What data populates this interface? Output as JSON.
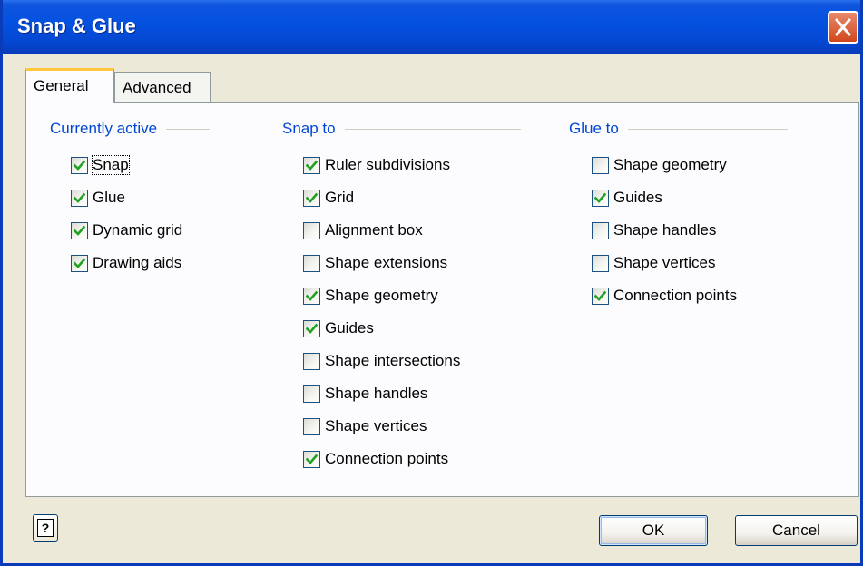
{
  "window": {
    "title": "Snap & Glue",
    "close_icon": "close-icon"
  },
  "tabs": [
    {
      "label": "General",
      "active": true
    },
    {
      "label": "Advanced",
      "active": false
    }
  ],
  "groups": {
    "currently_active": {
      "title": "Currently active",
      "items": [
        {
          "label": "Snap",
          "checked": true
        },
        {
          "label": "Glue",
          "checked": true
        },
        {
          "label": "Dynamic grid",
          "checked": true
        },
        {
          "label": "Drawing aids",
          "checked": true
        }
      ]
    },
    "snap_to": {
      "title": "Snap to",
      "items": [
        {
          "label": "Ruler subdivisions",
          "checked": true
        },
        {
          "label": "Grid",
          "checked": true
        },
        {
          "label": "Alignment box",
          "checked": false
        },
        {
          "label": "Shape extensions",
          "checked": false
        },
        {
          "label": "Shape geometry",
          "checked": true
        },
        {
          "label": "Guides",
          "checked": true
        },
        {
          "label": "Shape intersections",
          "checked": false
        },
        {
          "label": "Shape handles",
          "checked": false
        },
        {
          "label": "Shape vertices",
          "checked": false
        },
        {
          "label": "Connection points",
          "checked": true
        }
      ]
    },
    "glue_to": {
      "title": "Glue to",
      "items": [
        {
          "label": "Shape geometry",
          "checked": false
        },
        {
          "label": "Guides",
          "checked": true
        },
        {
          "label": "Shape handles",
          "checked": false
        },
        {
          "label": "Shape vertices",
          "checked": false
        },
        {
          "label": "Connection points",
          "checked": true
        }
      ]
    }
  },
  "footer": {
    "help_icon": "help-icon",
    "help_glyph": "?",
    "ok_label": "OK",
    "cancel_label": "Cancel"
  },
  "colors": {
    "titlebar": "#0551e0",
    "group_title": "#0046d5",
    "check": "#21a121",
    "dialog_bg": "#ece9d8"
  }
}
